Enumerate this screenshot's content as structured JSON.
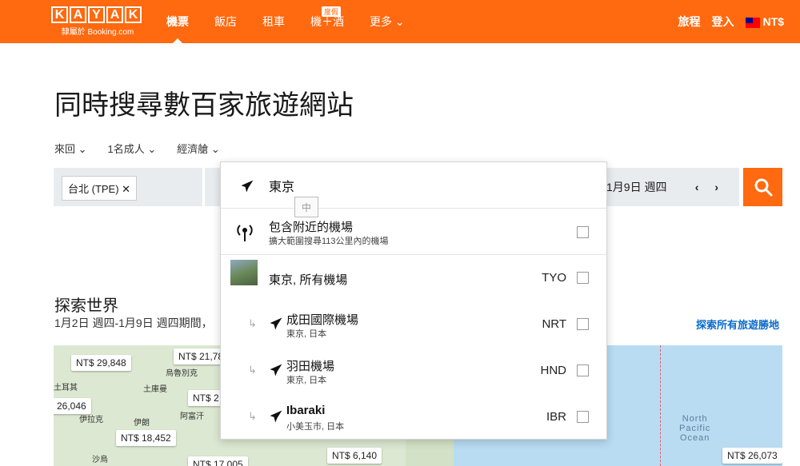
{
  "header": {
    "logo_letters": [
      "K",
      "A",
      "Y",
      "A",
      "K"
    ],
    "logo_sub": "隸屬於 Booking.com",
    "nav": [
      {
        "label": "機票",
        "active": true
      },
      {
        "label": "飯店"
      },
      {
        "label": "租車"
      },
      {
        "label": "機＋酒",
        "badge": "度假"
      },
      {
        "label": "更多 ⌄"
      }
    ],
    "trips": "旅程",
    "login": "登入",
    "currency": "NT$"
  },
  "title": "同時搜尋數百家旅遊網站",
  "options": {
    "trip_type": "來回 ⌄",
    "travelers": "1名成人 ⌄",
    "cabin": "經濟艙 ⌄"
  },
  "search": {
    "origin_chip": "台北 (TPE) ✕",
    "return_date": "1月9日 週四",
    "date_arrows": "‹ ›"
  },
  "dropdown": {
    "input_value": "東京",
    "ime_indicator": "中",
    "nearby": {
      "title": "包含附近的機場",
      "subtitle": "擴大範圍搜尋113公里內的機場"
    },
    "results": [
      {
        "name": "東京, 所有機場",
        "code": "TYO",
        "level": "city"
      },
      {
        "name": "成田國際機場",
        "sub": "東京, 日本",
        "code": "NRT",
        "level": "airport"
      },
      {
        "name": "羽田機場",
        "sub": "東京, 日本",
        "code": "HND",
        "level": "airport"
      },
      {
        "name": "Ibaraki",
        "sub": "小美玉市, 日本",
        "code": "IBR",
        "level": "airport"
      }
    ]
  },
  "explore": {
    "title": "探索世界",
    "subtitle": "1月2日 週四-1月9日 週四期間，",
    "link": "探索所有旅遊勝地"
  },
  "map": {
    "ocean": [
      "North",
      "Pacific",
      "Ocean"
    ],
    "place_labels": [
      "烏魯別克",
      "土庫曼",
      "伊拉克",
      "伊朗",
      "阿富汗",
      "沙烏",
      "土耳其"
    ],
    "prices": [
      "NT$ 29,848",
      "NT$ 21,78",
      "26,046",
      "NT$ 2",
      "NT$ 18,452",
      "NT$ 17,005",
      "NT$ 6,140",
      "NT$ 26,073"
    ]
  },
  "colors": {
    "brand": "#ff690f",
    "link": "#0b6bcb",
    "ocean": "#b9dcf3"
  }
}
